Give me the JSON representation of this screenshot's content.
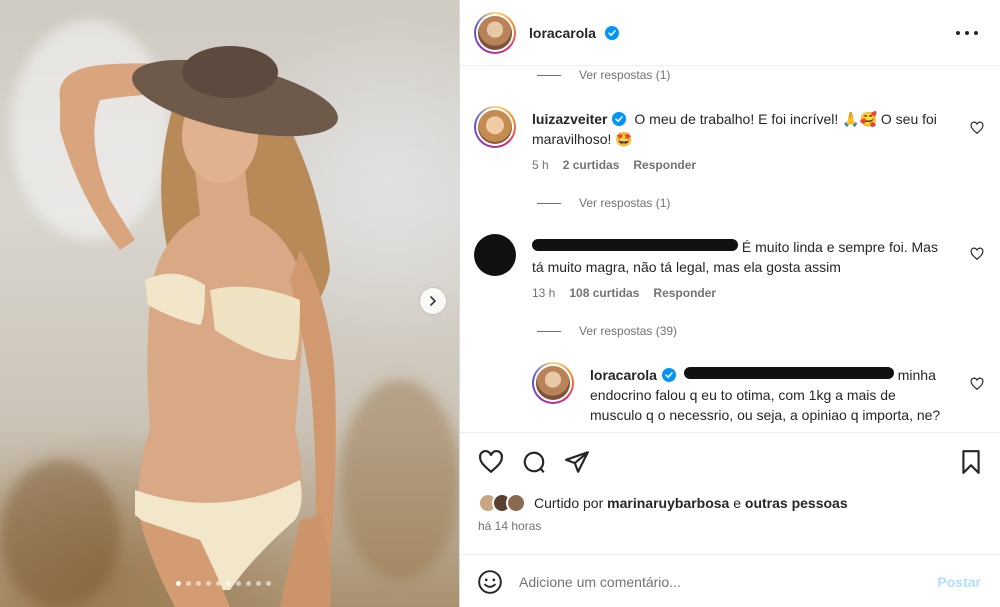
{
  "post": {
    "author": "loracarola",
    "verified": true,
    "image_alt": "Woman in straw hat and cream bikini in front of a concrete wall",
    "carousel": {
      "dots": 10,
      "active_index": 1
    }
  },
  "comments": {
    "view_replies_1": "Ver respostas (1)",
    "c1": {
      "user": "luizazveiter",
      "text": "O meu de trabalho! E foi incrível! 🙏🥰 O seu foi maravilhoso! 🤩",
      "time": "5 h",
      "likes": "2 curtidas",
      "reply": "Responder"
    },
    "view_replies_2": "Ver respostas (1)",
    "c2": {
      "text": "É muito linda e sempre foi. Mas tá muito magra, não tá legal, mas ela gosta assim",
      "time": "13 h",
      "likes": "108 curtidas",
      "reply": "Responder"
    },
    "view_replies_3": "Ver respostas (39)",
    "c3": {
      "user": "loracarola",
      "text": "minha endocrino falou q eu to otima, com 1kg a mais de musculo q o necessrio, ou seja, a opiniao q importa, ne?"
    }
  },
  "footer": {
    "liked_by_prefix": "Curtido por",
    "liked_by_user": "marinaruybarbosa",
    "liked_by_and": "e",
    "liked_by_others": "outras pessoas",
    "time_ago": "há 14 horas",
    "comment_placeholder": "Adicione um comentário...",
    "post_label": "Postar"
  },
  "colors": {
    "verified": "#0095f6",
    "link_disabled": "#b2dffc",
    "muted": "#737373"
  }
}
